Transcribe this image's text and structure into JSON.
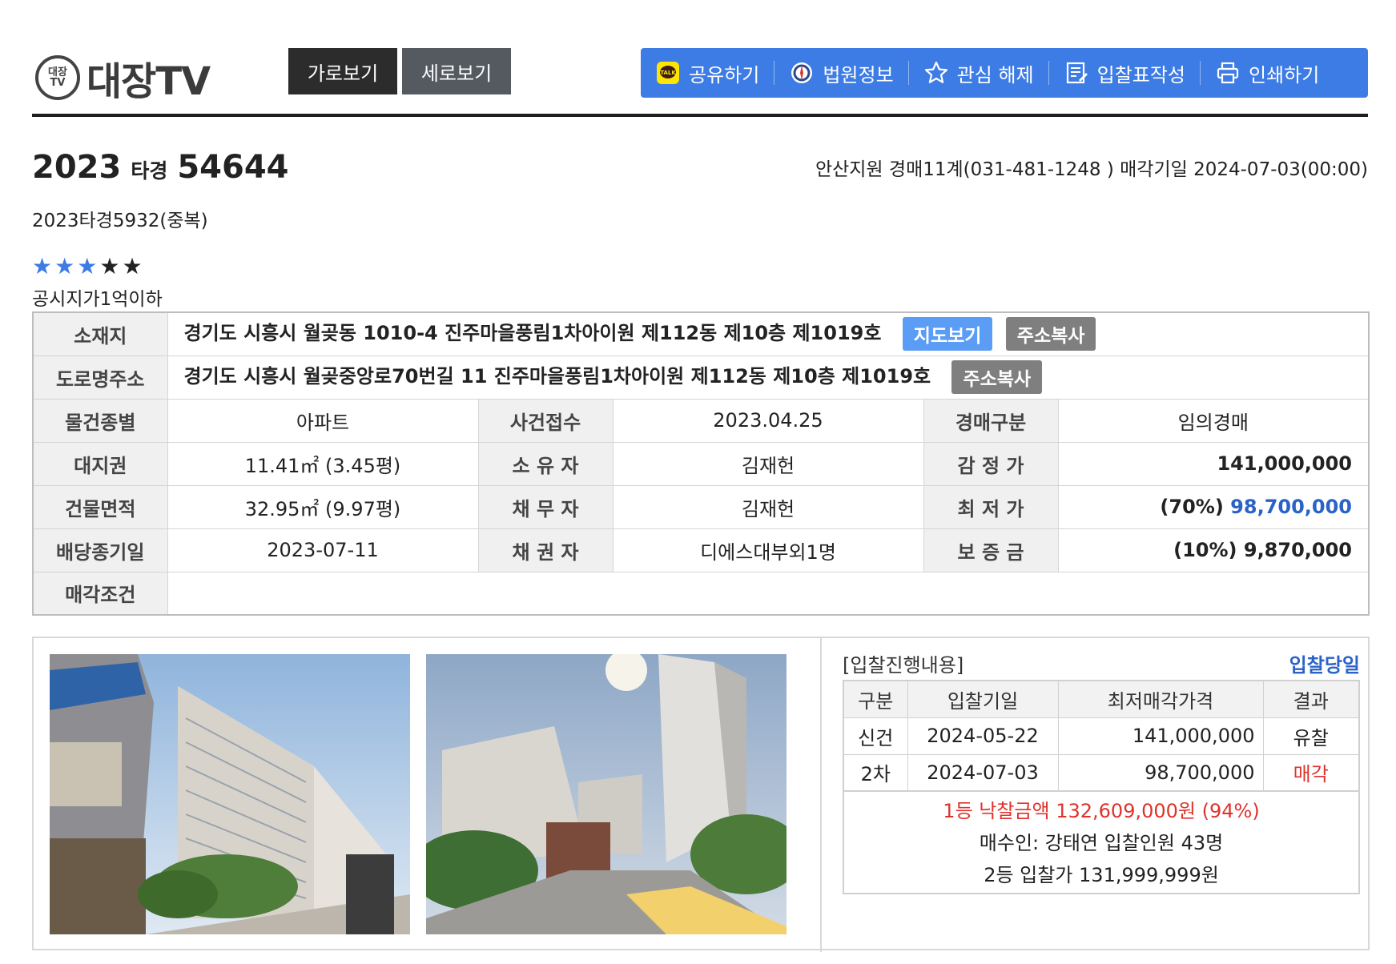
{
  "logo": {
    "badge_top": "대장",
    "badge_bottom": "TV",
    "text": "대장TV"
  },
  "view": {
    "horizontal": "가로보기",
    "vertical": "세로보기"
  },
  "toolbar": {
    "share": "공유하기",
    "court": "법원정보",
    "unfavorite": "관심 해제",
    "bid_form": "입찰표작성",
    "print": "인쇄하기",
    "talk": "TALK"
  },
  "case": {
    "year": "2023",
    "type": "타경",
    "number": "54644",
    "court_info": "안산지원 경매11계(031-481-1248 ) 매각기일 2024-07-03(00:00)",
    "duplicate": "2023타경5932(중복)",
    "rating": 3,
    "rating_max": 5,
    "tagline": "공시지가1억이하"
  },
  "info": {
    "location_label": "소재지",
    "location_value": "경기도 시흥시 월곶동 1010-4 진주마을풍림1차아이원 제112동 제10층 제1019호",
    "map_button": "지도보기",
    "copy_button": "주소복사",
    "road_label": "도로명주소",
    "road_value": "경기도 시흥시 월곶중앙로70번길 11 진주마을풍림1차아이원 제112동 제10층 제1019호",
    "rows": [
      {
        "l1": "물건종별",
        "v1": "아파트",
        "l2": "사건접수",
        "v2": "2023.04.25",
        "l3": "경매구분",
        "v3": "임의경매"
      },
      {
        "l1": "대지권",
        "v1": "11.41㎡ (3.45평)",
        "l2": "소 유 자",
        "v2": "김재헌",
        "l3": "감 정 가",
        "v3": "141,000,000"
      },
      {
        "l1": "건물면적",
        "v1": "32.95㎡ (9.97평)",
        "l2": "채 무 자",
        "v2": "김재헌",
        "l3": "최 저 가",
        "v3a": "(70%) ",
        "v3b": "98,700,000"
      },
      {
        "l1": "배당종기일",
        "v1": "2023-07-11",
        "l2": "채 권 자",
        "v2": "디에스대부외1명",
        "l3": "보 증 금",
        "v3": "(10%) 9,870,000"
      }
    ],
    "sale_cond_label": "매각조건",
    "sale_cond_value": ""
  },
  "bid": {
    "heading": "[입찰진행내용]",
    "day_link": "입찰당일",
    "columns": [
      "구분",
      "입찰기일",
      "최저매각가격",
      "결과"
    ],
    "rows": [
      {
        "round": "신건",
        "date": "2024-05-22",
        "price": "141,000,000",
        "result": "유찰"
      },
      {
        "round": "2차",
        "date": "2024-07-03",
        "price": "98,700,000",
        "result": "매각"
      }
    ],
    "winning": "1등 낙찰금액 132,609,000원 (94%)",
    "buyer": "매수인: 강태연 입찰인원 43명",
    "second": "2등 입찰가 131,999,999원"
  },
  "colors": {
    "accent": "#3d7ce4",
    "red": "#e0322b",
    "link_blue": "#2a62c8"
  }
}
